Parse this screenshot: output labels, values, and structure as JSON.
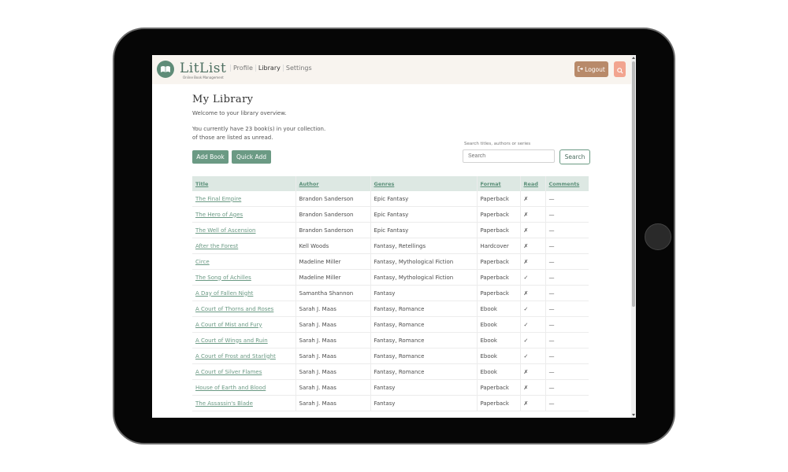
{
  "app": {
    "brand": "LitList",
    "tagline": "Online Book Management"
  },
  "nav": {
    "items": [
      "Profile",
      "Library",
      "Settings"
    ],
    "active": "Library",
    "logout_label": "Logout"
  },
  "page": {
    "title": "My Library",
    "welcome": "Welcome to your library overview.",
    "summary_line1": "You currently have 23 book(s) in your collection.",
    "summary_line2": "of those are listed as unread."
  },
  "actions": {
    "add_book": "Add Book",
    "quick_add": "Quick Add"
  },
  "search": {
    "label": "Search titles, authors or series",
    "placeholder": "Search",
    "button": "Search"
  },
  "table": {
    "headers": [
      "Title",
      "Author",
      "Genres",
      "Format",
      "Read",
      "Comments"
    ],
    "rows": [
      {
        "title": "The Final Empire",
        "author": "Brandon Sanderson",
        "genres": "Epic Fantasy",
        "format": "Paperback",
        "read": "✗",
        "comments": "—"
      },
      {
        "title": "The Hero of Ages",
        "author": "Brandon Sanderson",
        "genres": "Epic Fantasy",
        "format": "Paperback",
        "read": "✗",
        "comments": "—"
      },
      {
        "title": "The Well of Ascension",
        "author": "Brandon Sanderson",
        "genres": "Epic Fantasy",
        "format": "Paperback",
        "read": "✗",
        "comments": "—"
      },
      {
        "title": "After the Forest",
        "author": "Kell Woods",
        "genres": "Fantasy, Retellings",
        "format": "Hardcover",
        "read": "✗",
        "comments": "—"
      },
      {
        "title": "Circe",
        "author": "Madeline Miller",
        "genres": "Fantasy, Mythological Fiction",
        "format": "Paperback",
        "read": "✗",
        "comments": "—"
      },
      {
        "title": "The Song of Achilles",
        "author": "Madeline Miller",
        "genres": "Fantasy, Mythological Fiction",
        "format": "Paperback",
        "read": "✓",
        "comments": "—"
      },
      {
        "title": "A Day of Fallen Night",
        "author": "Samantha Shannon",
        "genres": "Fantasy",
        "format": "Paperback",
        "read": "✗",
        "comments": "—"
      },
      {
        "title": "A Court of Thorns and Roses",
        "author": "Sarah J. Maas",
        "genres": "Fantasy, Romance",
        "format": "Ebook",
        "read": "✓",
        "comments": "—"
      },
      {
        "title": "A Court of Mist and Fury",
        "author": "Sarah J. Maas",
        "genres": "Fantasy, Romance",
        "format": "Ebook",
        "read": "✓",
        "comments": "—"
      },
      {
        "title": "A Court of Wings and Ruin",
        "author": "Sarah J. Maas",
        "genres": "Fantasy, Romance",
        "format": "Ebook",
        "read": "✓",
        "comments": "—"
      },
      {
        "title": "A Court of Frost and Starlight",
        "author": "Sarah J. Maas",
        "genres": "Fantasy, Romance",
        "format": "Ebook",
        "read": "✓",
        "comments": "—"
      },
      {
        "title": "A Court of Silver Flames",
        "author": "Sarah J. Maas",
        "genres": "Fantasy, Romance",
        "format": "Ebook",
        "read": "✗",
        "comments": "—"
      },
      {
        "title": "House of Earth and Blood",
        "author": "Sarah J. Maas",
        "genres": "Fantasy",
        "format": "Paperback",
        "read": "✗",
        "comments": "—"
      },
      {
        "title": "The Assassin's Blade",
        "author": "Sarah J. Maas",
        "genres": "Fantasy",
        "format": "Paperback",
        "read": "✗",
        "comments": "—"
      }
    ]
  },
  "colors": {
    "accent": "#6b9a84",
    "brand_text": "#4d6f61",
    "logout": "#b88a6a",
    "search_icon_bg": "#f2a48f",
    "header_bg": "#f8f4ef",
    "table_header_bg": "#dde8e3"
  },
  "icons": {
    "logo": "open-book-icon",
    "logout": "sign-out-icon",
    "search": "search-icon",
    "tablet_home": "home-button"
  }
}
